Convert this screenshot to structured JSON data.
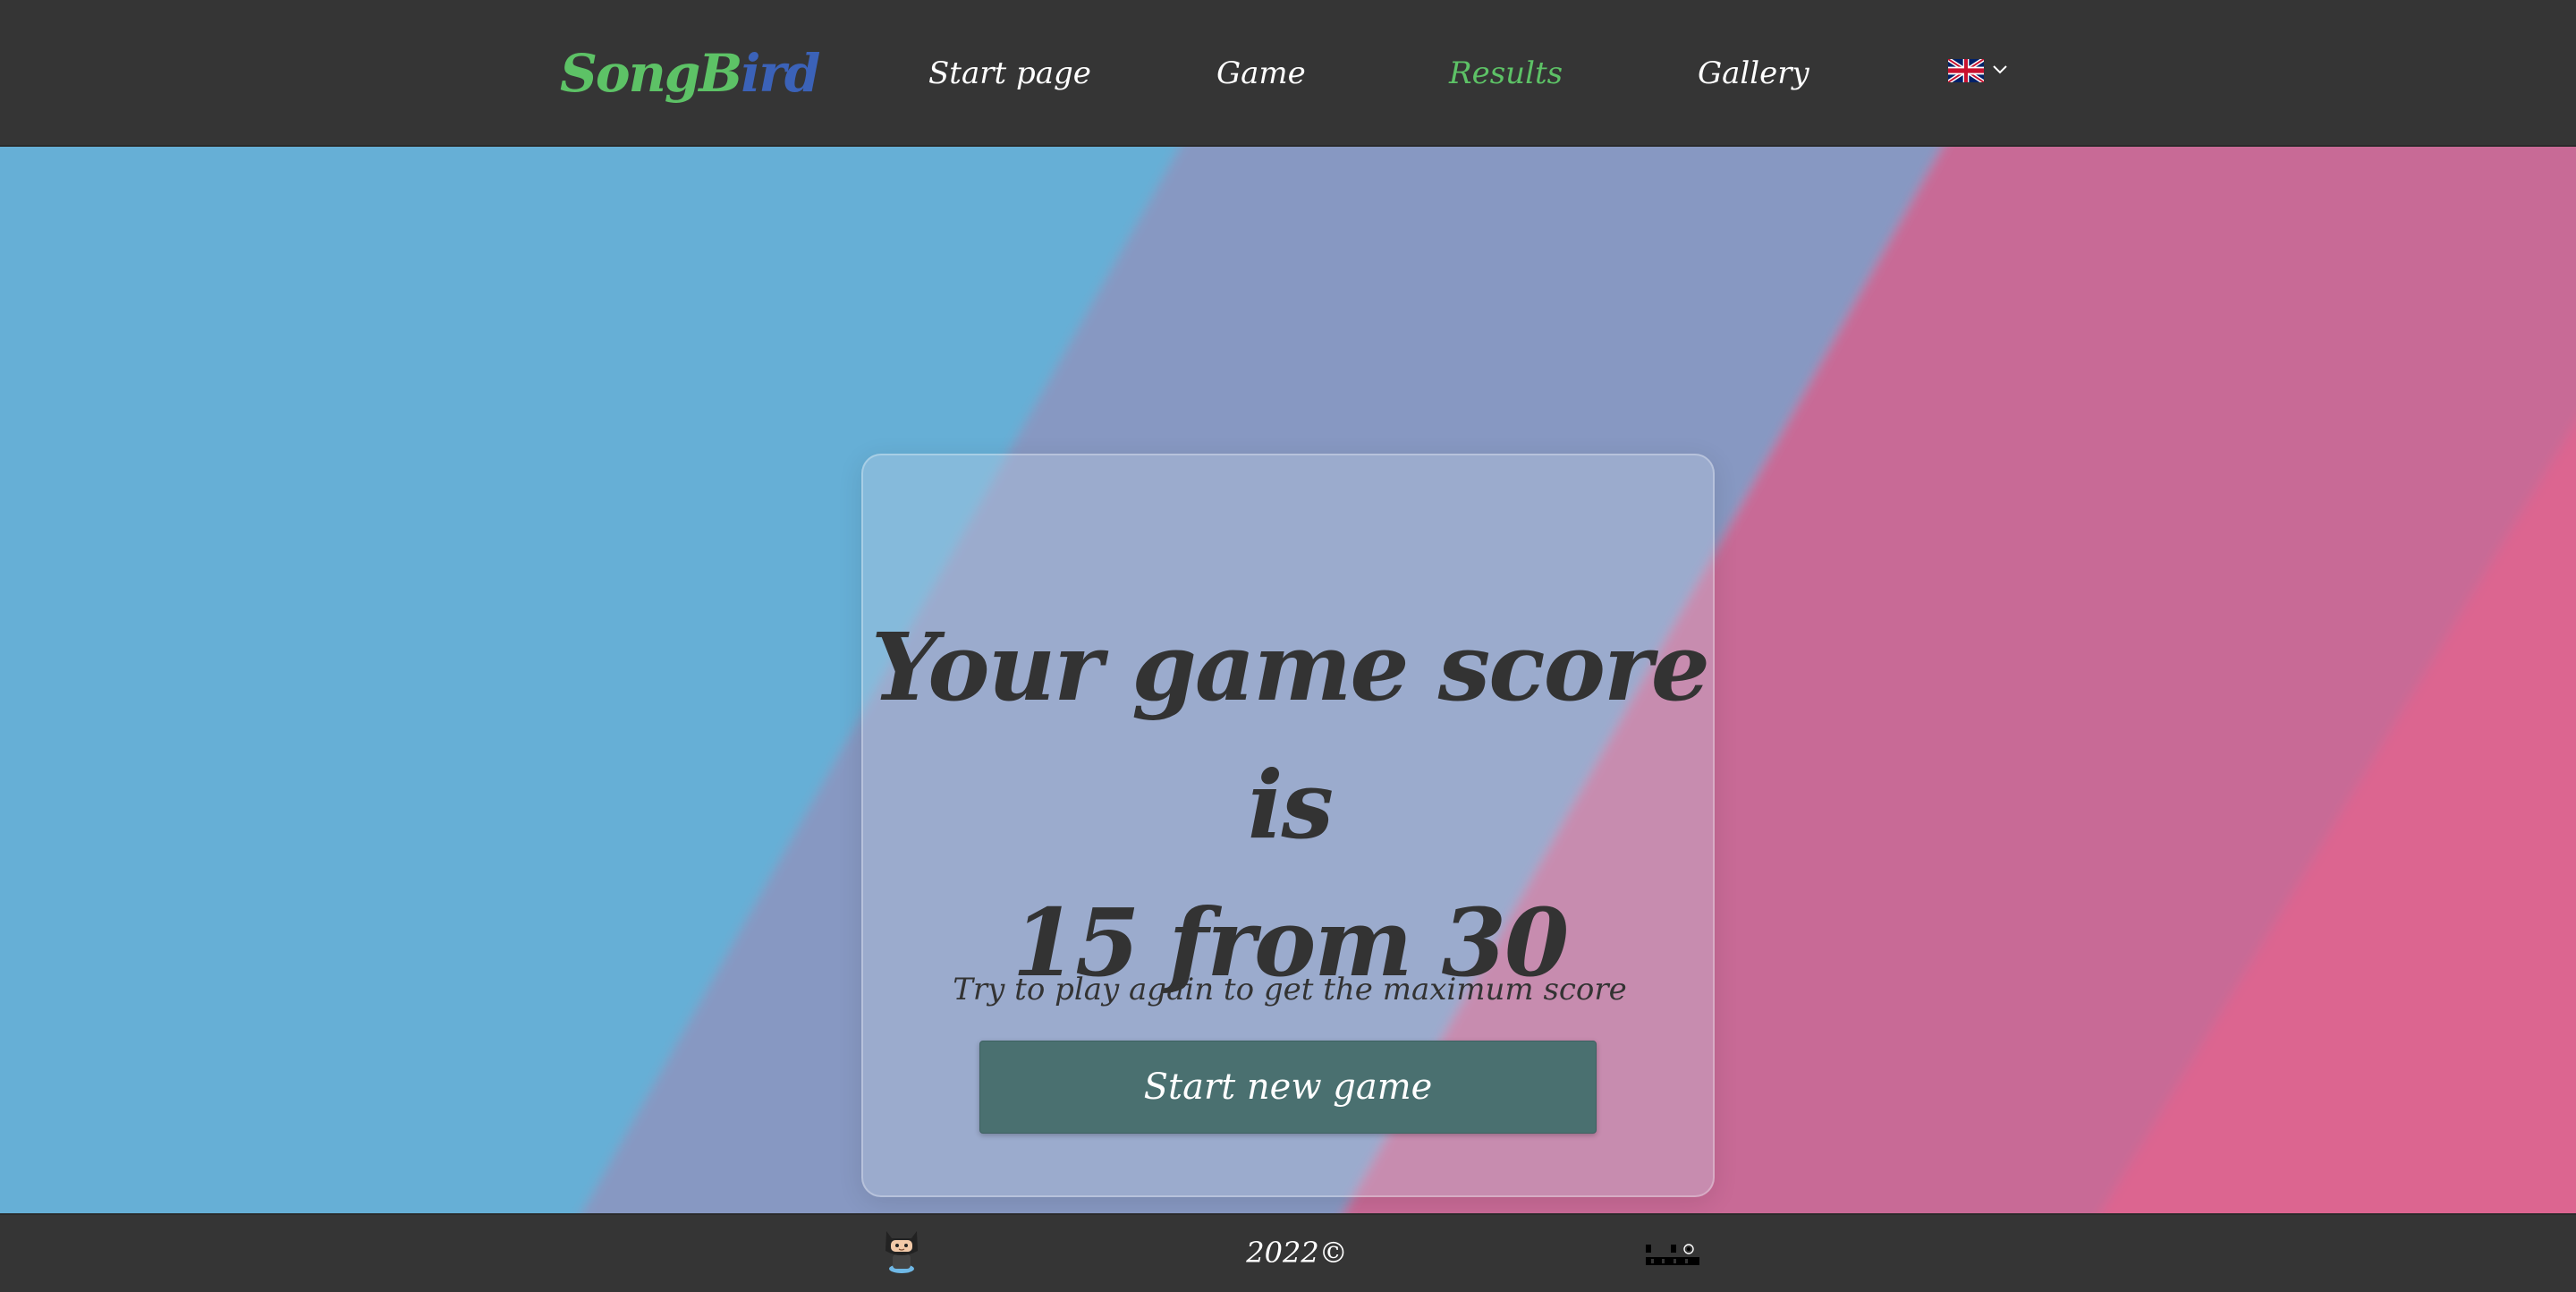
{
  "header": {
    "logo": {
      "part1": "SongB",
      "part2": "ird"
    },
    "nav": [
      {
        "label": "Start page",
        "active": false
      },
      {
        "label": "Game",
        "active": false
      },
      {
        "label": "Results",
        "active": true
      },
      {
        "label": "Gallery",
        "active": false
      }
    ],
    "language": {
      "icon": "uk-flag-icon",
      "dropdown_icon": "chevron-down-icon"
    }
  },
  "result": {
    "title_line1": "Your game score is",
    "title_line2": "15 from 30",
    "score": 15,
    "max_score": 30,
    "subtitle": "Try to play again to get the maximum score",
    "button_label": "Start new game"
  },
  "footer": {
    "github_icon": "github-icon",
    "copyright": "2022©",
    "school_logo_icon": "rs-school-logo-icon"
  },
  "colors": {
    "header_bg": "#353535",
    "accent_green": "#5dc266",
    "logo_blue": "#3b62b8",
    "button_bg": "#4a7070",
    "text_dark": "#333333",
    "bg_blue": "#66afd6",
    "bg_purple": "#8798c2",
    "bg_pink": "#c86b96",
    "bg_pink_strong": "#dc6590"
  }
}
